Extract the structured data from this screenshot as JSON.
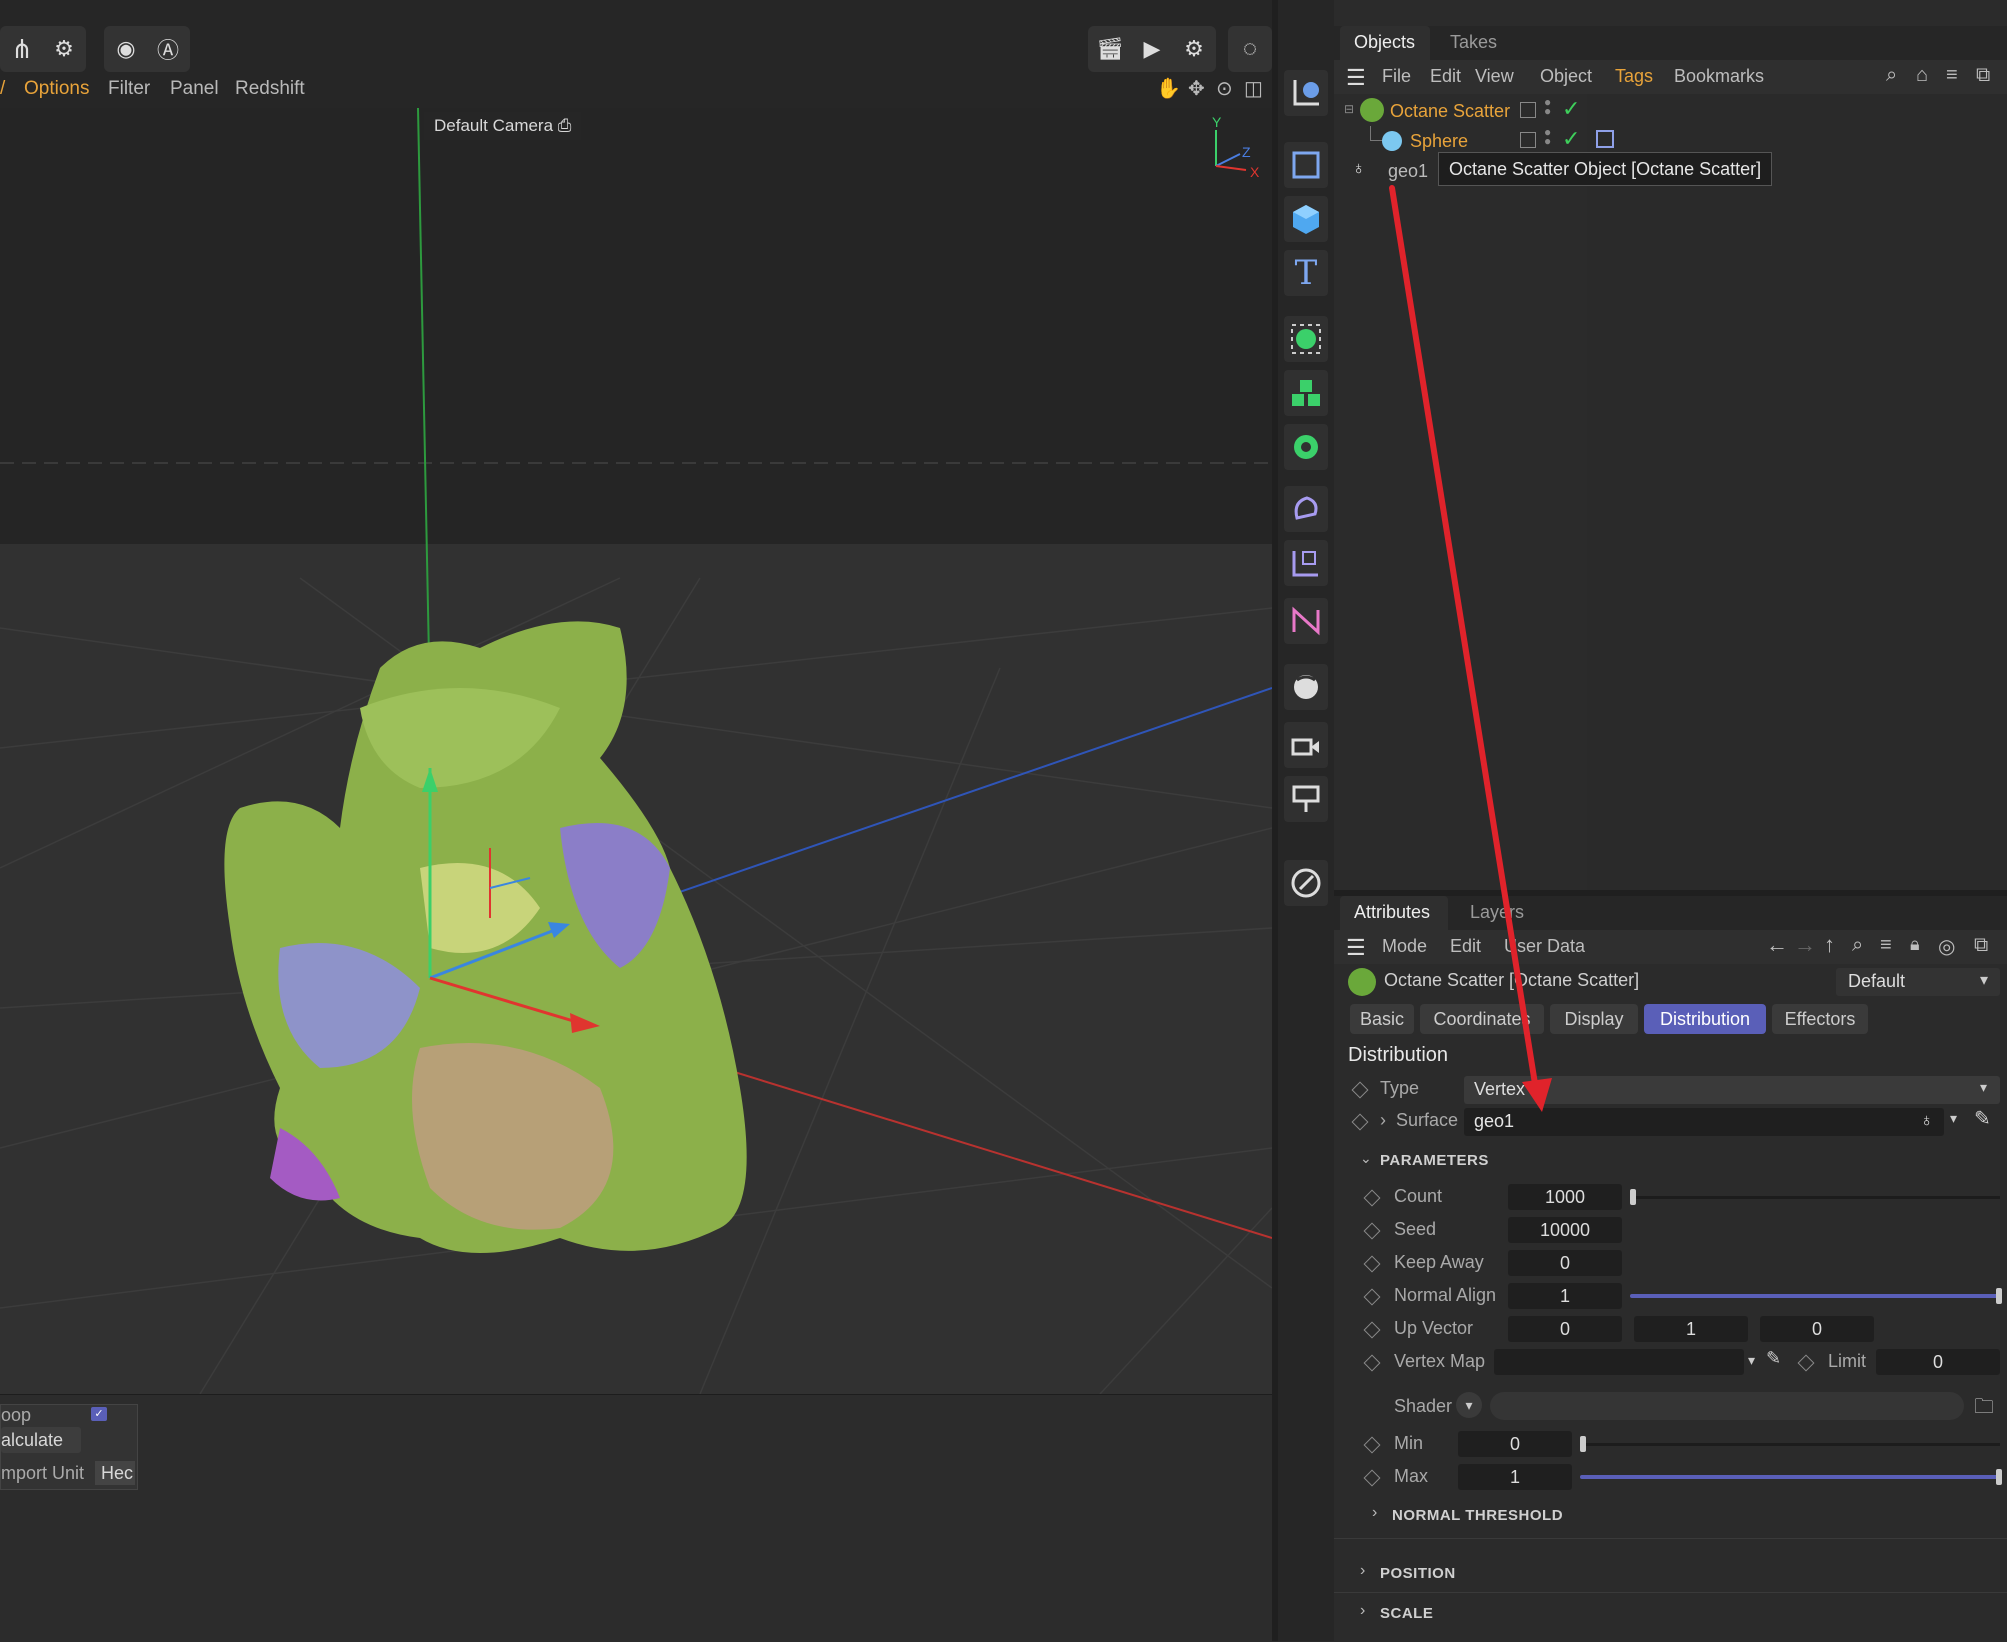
{
  "viewport": {
    "menu": [
      "Options",
      "Filter",
      "Panel",
      "Redshift"
    ],
    "camera_label": "Default Camera",
    "axis_labels": {
      "y": "Y",
      "z": "Z",
      "x": "X"
    },
    "hud": {
      "row1": "oop",
      "row2": "alculate",
      "row3_label": "mport Unit",
      "row3_value": "Hec"
    }
  },
  "objects_panel": {
    "tabs": [
      "Objects",
      "Takes"
    ],
    "menu": [
      "File",
      "Edit",
      "View",
      "Object",
      "Tags",
      "Bookmarks"
    ],
    "rows": [
      {
        "name": "Octane Scatter"
      },
      {
        "name": "Sphere"
      },
      {
        "name": "geo1"
      }
    ],
    "tooltip": "Octane Scatter Object [Octane Scatter]"
  },
  "attributes_panel": {
    "tabs": [
      "Attributes",
      "Layers"
    ],
    "menu": [
      "Mode",
      "Edit",
      "User Data"
    ],
    "object_title": "Octane Scatter [Octane Scatter]",
    "preset": "Default",
    "sub_tabs": [
      "Basic",
      "Coordinates",
      "Display",
      "Distribution",
      "Effectors"
    ],
    "active_sub_tab": "Distribution",
    "section_title": "Distribution",
    "type_label": "Type",
    "type_value": "Vertex",
    "surface_label": "Surface",
    "surface_value": "geo1",
    "parameters_label": "PARAMETERS",
    "params": {
      "count": {
        "label": "Count",
        "value": "1000",
        "slider": 0.0
      },
      "seed": {
        "label": "Seed",
        "value": "10000"
      },
      "keep_away": {
        "label": "Keep Away",
        "value": "0"
      },
      "normal_align": {
        "label": "Normal Align",
        "value": "1",
        "slider": 1.0
      },
      "up_vector": {
        "label": "Up Vector",
        "x": "0",
        "y": "1",
        "z": "0"
      },
      "vertex_map": {
        "label": "Vertex Map",
        "value": ""
      },
      "limit": {
        "label": "Limit",
        "value": "0"
      },
      "shader": {
        "label": "Shader"
      },
      "min": {
        "label": "Min",
        "value": "0",
        "slider": 0.0
      },
      "max": {
        "label": "Max",
        "value": "1",
        "slider": 1.0
      }
    },
    "collapsed_sections": [
      "NORMAL THRESHOLD",
      "POSITION",
      "SCALE"
    ]
  },
  "colors": {
    "accent_active": "#5a5fb8",
    "object_orange": "#e8a33a",
    "check_green": "#3ecf5b",
    "annotation_arrow": "#e0232b"
  }
}
